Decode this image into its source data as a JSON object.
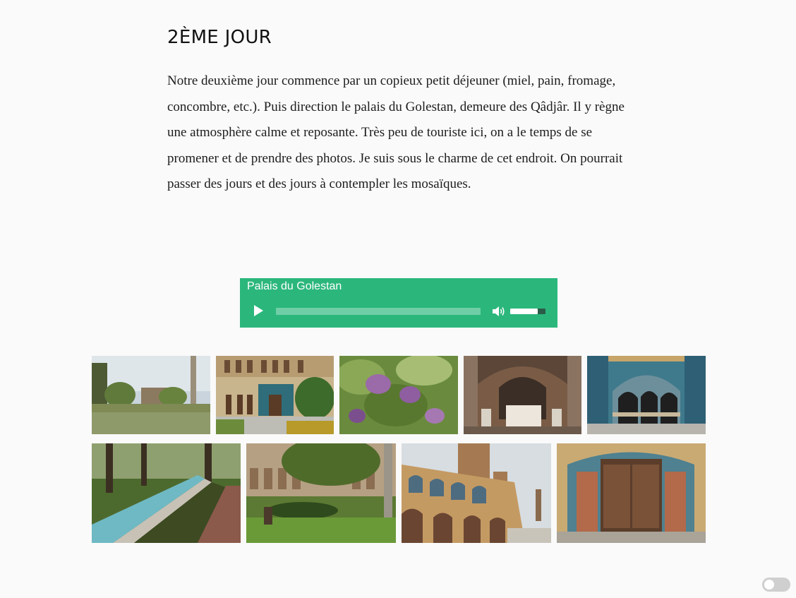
{
  "heading": "2ÈME JOUR",
  "paragraph": "Notre deuxième jour commence par un copieux petit déjeuner (miel, pain, fromage, concombre, etc.). Puis direction le palais du Golestan, demeure des Qâdjâr. Il y règne une atmosphère calme et reposante. Très peu de touriste ici, on a le temps de se promener et de prendre des photos. Je suis sous le charme de cet endroit. On pourrait passer des jours et des jours à contempler les mosaïques.",
  "audio_player": {
    "title": "Palais du Golestan",
    "progress": 0,
    "volume": 0.78,
    "accent_color": "#2bb77c",
    "icons": [
      "play-icon",
      "volume-icon"
    ]
  },
  "gallery": {
    "row1": [
      "garden-pool-photo",
      "palace-facade-photo",
      "lilac-flowers-photo",
      "carved-throne-hall-photo",
      "tiled-arcade-photo"
    ],
    "row2": [
      "garden-water-channel-photo",
      "palace-garden-trees-photo",
      "wind-tower-building-photo",
      "tiled-wooden-door-photo"
    ]
  },
  "theme_toggle": {
    "on": false
  }
}
